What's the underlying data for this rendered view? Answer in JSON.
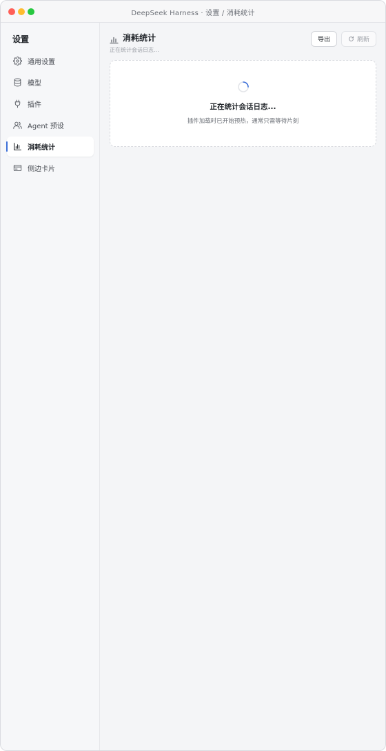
{
  "window": {
    "title": "DeepSeek Harness · 设置 / 消耗统计"
  },
  "sidebar": {
    "title": "设置",
    "items": [
      {
        "label": "通用设置",
        "icon": "gear-icon",
        "active": false
      },
      {
        "label": "模型",
        "icon": "database-icon",
        "active": false
      },
      {
        "label": "插件",
        "icon": "plug-icon",
        "active": false
      },
      {
        "label": "Agent 预设",
        "icon": "users-icon",
        "active": false
      },
      {
        "label": "消耗统计",
        "icon": "bar-chart-icon",
        "active": true
      },
      {
        "label": "侧边卡片",
        "icon": "card-icon",
        "active": false
      }
    ]
  },
  "header": {
    "icon": "bar-chart-icon",
    "title": "消耗统计",
    "subtitle": "正在统计会话日志...",
    "export_label": "导出",
    "refresh_label": "刷新"
  },
  "loading": {
    "title": "正在统计会话日志...",
    "description": "插件加载时已开始预热，通常只需等待片刻"
  },
  "colors": {
    "accent": "#3b6fd8",
    "background": "#f4f5f7",
    "sidebar_bg": "#f6f7f9",
    "card_bg": "#ffffff"
  }
}
